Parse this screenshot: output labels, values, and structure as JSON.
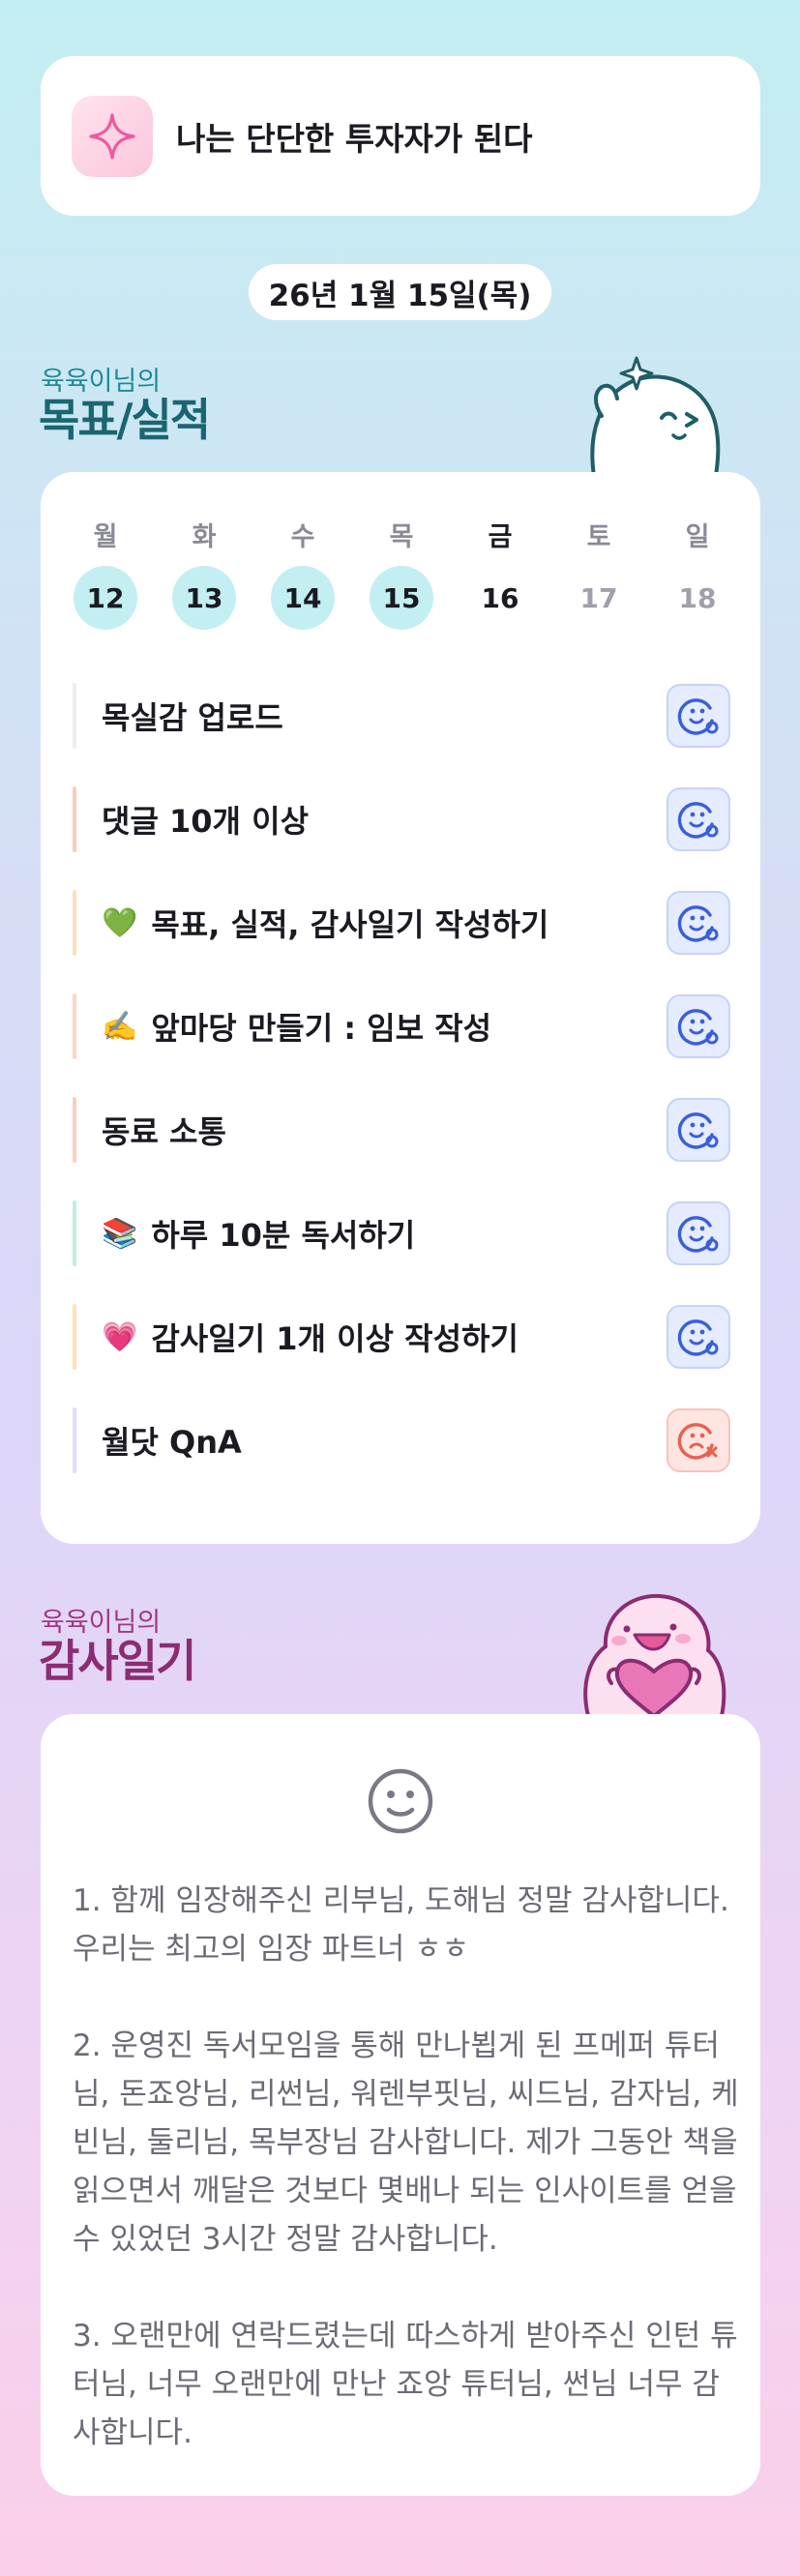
{
  "motto": {
    "icon": "sparkle-icon",
    "text": "나는 단단한 투자자가 된다"
  },
  "date_label": "26년 1월 15일(목)",
  "goals_section": {
    "owner": "육육이님의",
    "title": "목표/실적",
    "owner_color": "#1f8a96",
    "title_color": "#1a6670"
  },
  "week": [
    {
      "name": "월",
      "num": "12",
      "state": "done"
    },
    {
      "name": "화",
      "num": "13",
      "state": "done"
    },
    {
      "name": "수",
      "num": "14",
      "state": "done"
    },
    {
      "name": "목",
      "num": "15",
      "state": "done"
    },
    {
      "name": "금",
      "num": "16",
      "state": "today"
    },
    {
      "name": "토",
      "num": "17",
      "state": "future"
    },
    {
      "name": "일",
      "num": "18",
      "state": "future"
    }
  ],
  "tasks": [
    {
      "emoji": "",
      "label": "목실감 업로드",
      "bar_color": "#ececf2",
      "status": "done"
    },
    {
      "emoji": "",
      "label": "댓글 10개 이상",
      "bar_color": "#f7cdbd",
      "status": "done"
    },
    {
      "emoji": "💚",
      "label": "목표, 실적, 감사일기 작성하기",
      "bar_color": "#fbe0bd",
      "status": "done"
    },
    {
      "emoji": "✍️",
      "label": "앞마당 만들기 : 임보 작성",
      "bar_color": "#fbd7c5",
      "status": "done"
    },
    {
      "emoji": "",
      "label": "동료 소통",
      "bar_color": "#f9cfc2",
      "status": "done"
    },
    {
      "emoji": "📚",
      "label": "하루 10분 독서하기",
      "bar_color": "#bfeedd",
      "status": "done"
    },
    {
      "emoji": "💗",
      "label": "감사일기 1개 이상 작성하기",
      "bar_color": "#fde1b8",
      "status": "done"
    },
    {
      "emoji": "",
      "label": "월닷 QnA",
      "bar_color": "#dcdff6",
      "status": "missed"
    }
  ],
  "diary_section": {
    "owner": "육육이님의",
    "title": "감사일기",
    "owner_color": "#a03880",
    "title_color": "#8c2c72"
  },
  "diary": {
    "icon": "smile-icon",
    "entries": [
      "1. 함께 임장해주신 리부님, 도해님 정말 감사합니다. 우리는 최고의 임장 파트너 ㅎㅎ",
      "2. 운영진 독서모임을 통해 만나뵙게 된 프메퍼 튜터님, 돈죠앙님, 리썬님, 워렌부핏님, 씨드님, 감자님, 케빈님, 둘리님, 목부장님 감사합니다. 제가 그동안 책을 읽으면서 깨달은 것보다 몇배나 되는 인사이트를 얻을 수 있었던 3시간 정말 감사합니다.",
      "3. 오랜만에 연락드렸는데 따스하게 받아주신 인턴 튜터님, 너무 오랜만에 만난 죠앙 튜터님, 썬님 너무 감사합니다."
    ]
  },
  "colors": {
    "done_day_bg": "#c3eff3",
    "ok_icon": "#3a5fd8",
    "fail_icon": "#e8614e"
  }
}
